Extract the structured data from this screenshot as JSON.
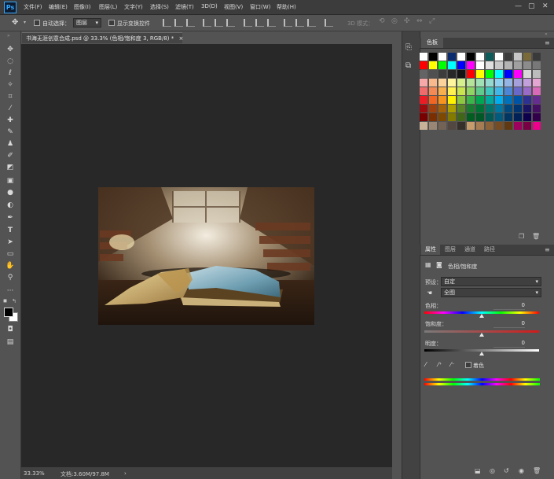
{
  "app": {
    "logo": "Ps"
  },
  "menu": [
    "文件(F)",
    "编辑(E)",
    "图像(I)",
    "图层(L)",
    "文字(Y)",
    "选择(S)",
    "滤镜(T)",
    "3D(D)",
    "视图(V)",
    "窗口(W)",
    "帮助(H)"
  ],
  "window_controls": {
    "minimize": "—",
    "restore": "▢",
    "close": "✕"
  },
  "options_bar": {
    "auto_select_label": "自动选择：",
    "auto_select_value": "图层",
    "show_transform_label": "显示变换控件",
    "mode_3d_label": "3D 模式："
  },
  "document": {
    "tab_title": "书海无涯创意合成.psd @ 33.3% (色相/饱和度 3, RGB/8) *",
    "tab_close": "×",
    "zoom": "33.33%",
    "doc_info": "文档:3.60M/97.8M",
    "status_arrow": "›"
  },
  "swatches_panel": {
    "tab": "色板",
    "colors": [
      "#ffffff",
      "#000000",
      "#ffffff",
      "#0a2c6e",
      "#ffffff",
      "#000000",
      "#ffffff",
      "#0c5a5a",
      "#ffffff",
      "#3b3b3b",
      "#c6c6c6",
      "#7a6a3a",
      "#3a3a3a",
      "#ff0000",
      "#ffff00",
      "#00ff00",
      "#00ffff",
      "#0000ff",
      "#ff00ff",
      "#ffffff",
      "#e0e0e0",
      "#c8c8c8",
      "#b4b4b4",
      "#a0a0a0",
      "#8c8c8c",
      "#787878",
      "#646464",
      "#505050",
      "#3c3c3c",
      "#282828",
      "#141414",
      "#ff0000",
      "#ffff00",
      "#00ff00",
      "#00ffff",
      "#0000ff",
      "#ff00ff",
      "#d8d8d8",
      "#bcbcbc",
      "#f7a8a8",
      "#f9b98d",
      "#fbd39a",
      "#fff59d",
      "#d7f08e",
      "#b6e39a",
      "#9fe0b5",
      "#93d9d0",
      "#8fd0ee",
      "#95b4e6",
      "#a59fdc",
      "#c3a0dc",
      "#e5a5d2",
      "#f06b6b",
      "#f38a55",
      "#f8b04e",
      "#fff152",
      "#c8e44e",
      "#8fd564",
      "#5ecb8c",
      "#3fc6bd",
      "#41b7e8",
      "#4d86d6",
      "#6a69c9",
      "#9a6ac9",
      "#d86ab9",
      "#ed1c24",
      "#f26522",
      "#f7941d",
      "#fff200",
      "#8dc63f",
      "#39b54a",
      "#00a651",
      "#00a99d",
      "#00aeef",
      "#0072bc",
      "#0054a6",
      "#2e3192",
      "#662d91",
      "#9e0b0f",
      "#a0410d",
      "#a36209",
      "#aba000",
      "#598527",
      "#197b30",
      "#007236",
      "#00746b",
      "#0076a3",
      "#004a80",
      "#003471",
      "#1b1464",
      "#440e62",
      "#790000",
      "#7b2e00",
      "#7d4900",
      "#827b00",
      "#406618",
      "#005e20",
      "#005826",
      "#005952",
      "#005b7f",
      "#003663",
      "#002157",
      "#0d004c",
      "#32004b",
      "#c7b299",
      "#998675",
      "#736357",
      "#534741",
      "#37302a",
      "#c69c6d",
      "#a67c52",
      "#8c6239",
      "#754c24",
      "#603913",
      "#9e005d",
      "#790044",
      "#ec008c"
    ]
  },
  "properties_panel": {
    "tabs": [
      "属性",
      "图层",
      "通道",
      "路径"
    ],
    "title": "色相/饱和度",
    "preset_label": "预设：",
    "preset_value": "自定",
    "channel_value": "全图",
    "hue_label": "色相：",
    "hue_value": "0",
    "saturation_label": "饱和度：",
    "saturation_value": "0",
    "lightness_label": "明度：",
    "lightness_value": "0",
    "colorize_label": "着色"
  }
}
